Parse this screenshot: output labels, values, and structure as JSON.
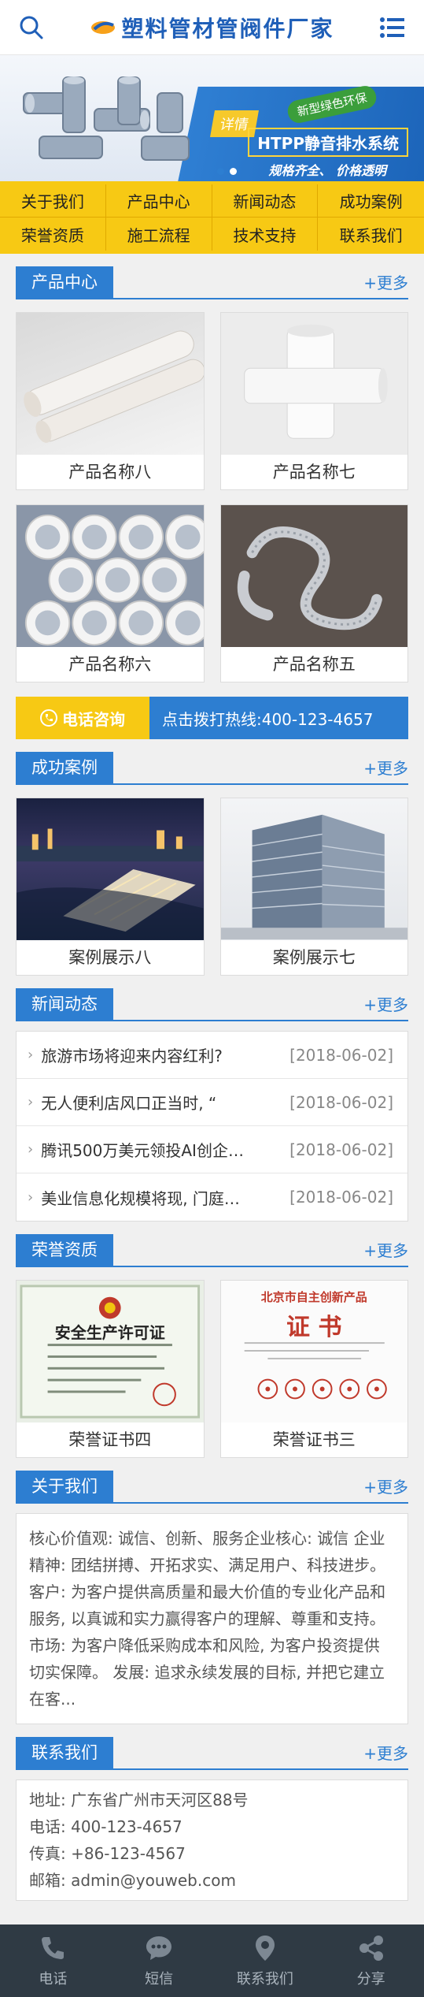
{
  "header": {
    "search_icon": "search-icon",
    "logo_text": "塑料管材管阀件厂家",
    "menu_icon": "menu-icon"
  },
  "banner": {
    "detail_tag": "详情",
    "green_tag": "新型绿色环保",
    "title": "HTPP静音排水系统",
    "subtitle": "规格齐全、 价格透明"
  },
  "nav": {
    "items": [
      "关于我们",
      "产品中心",
      "新闻动态",
      "成功案例",
      "荣誉资质",
      "施工流程",
      "技术支持",
      "联系我们"
    ]
  },
  "products": {
    "title": "产品中心",
    "more": "+更多",
    "items": [
      "产品名称八",
      "产品名称七",
      "产品名称六",
      "产品名称五"
    ]
  },
  "call": {
    "label": "电话咨询",
    "text": "点击拨打热线:400-123-4657"
  },
  "cases": {
    "title": "成功案例",
    "more": "+更多",
    "items": [
      "案例展示八",
      "案例展示七"
    ]
  },
  "news": {
    "title": "新闻动态",
    "more": "+更多",
    "items": [
      {
        "title": "旅游市场将迎来内容红利?",
        "date": "[2018-06-02]"
      },
      {
        "title": "无人便利店风口正当时, “",
        "date": "[2018-06-02]"
      },
      {
        "title": "腾讯500万美元领投AI创企…",
        "date": "[2018-06-02]"
      },
      {
        "title": "美业信息化规模将现, 门庭…",
        "date": "[2018-06-02]"
      }
    ]
  },
  "honors": {
    "title": "荣誉资质",
    "more": "+更多",
    "items": [
      "荣誉证书四",
      "荣誉证书三"
    ],
    "cert1_title": "安全生产许可证",
    "cert2_top": "北京市自主创新产品",
    "cert2_title": "证 书"
  },
  "about": {
    "title": "关于我们",
    "more": "+更多",
    "text": "核心价值观: 诚信、创新、服务企业核心: 诚信 企业精神: 团结拼搏、开拓求实、满足用户、科技进步。 客户: 为客户提供高质量和最大价值的专业化产品和服务, 以真诚和实力赢得客户的理解、尊重和支持。市场: 为客户降低采购成本和风险, 为客户投资提供切实保障。 发展: 追求永续发展的目标, 并把它建立在客..."
  },
  "contact": {
    "title": "联系我们",
    "more": "+更多",
    "lines": [
      "地址: 广东省广州市天河区88号",
      "电话: 400-123-4657",
      "传真: +86-123-4567",
      "邮箱: admin@youweb.com"
    ]
  },
  "footer": {
    "items": [
      "电话",
      "短信",
      "联系我们",
      "分享"
    ]
  },
  "colors": {
    "primary": "#2d7ed1",
    "accent": "#f7c914",
    "footer": "#2f3a44"
  }
}
